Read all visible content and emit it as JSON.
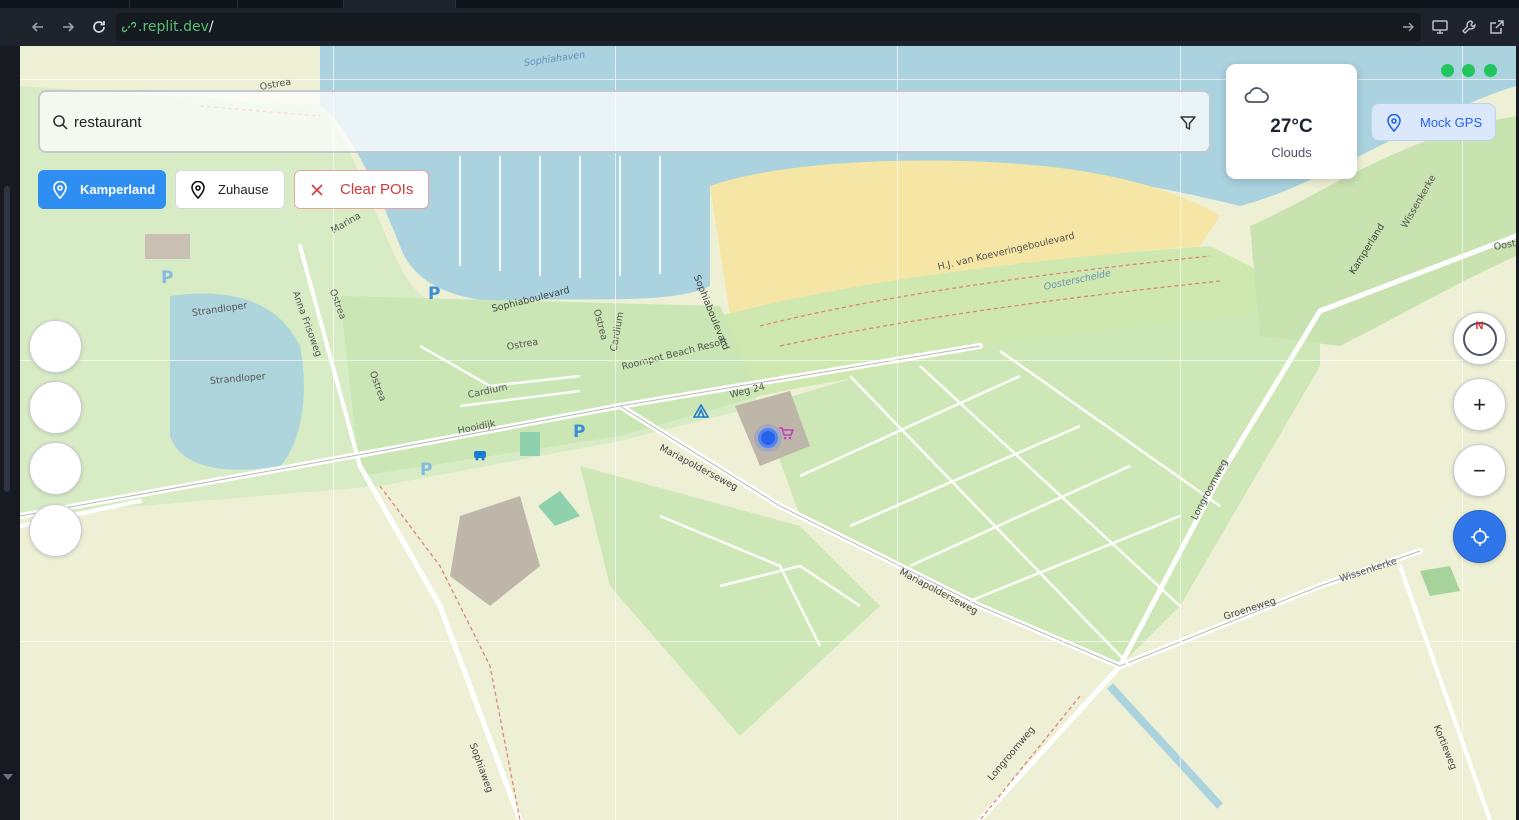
{
  "browser": {
    "url_domain": ".replit.dev",
    "url_path": "/"
  },
  "search": {
    "value": "restaurant",
    "placeholder": ""
  },
  "weather": {
    "temperature": "27°C",
    "condition": "Clouds",
    "icon": "cloud-icon"
  },
  "mock_gps": {
    "label": "Mock GPS"
  },
  "chips": {
    "kamperland": "Kamperland",
    "zuhause": "Zuhause",
    "clear_pois": "Clear POIs"
  },
  "controls": {
    "compass_label": "N",
    "zoom_in": "+",
    "zoom_out": "−"
  },
  "map": {
    "labels": {
      "sophiahaven": "Sophiahaven",
      "ostrea_1": "Ostrea",
      "ostrea_2": "Ostrea",
      "ostrea_3": "Ostrea",
      "ostrea_4": "Ostrea",
      "ostrea_5": "Ostrea",
      "marina": "Marina",
      "anna_frisoweg": "Anna Frisoweg",
      "strandloper_1": "Strandloper",
      "strandloper_2": "Strandloper",
      "sophiaboulevard_1": "Sophiaboulevard",
      "sophiaboulevard_2": "Sophiaboulevard",
      "cardium_1": "Cardium",
      "cardium_2": "Cardium",
      "roompot": "Roompot Beach Resort",
      "hooidijk": "Hooidijk",
      "weg24": "Weg 24",
      "mariapolderseweg_1": "Mariapolderseweg",
      "mariapolderseweg_2": "Mariapolderseweg",
      "koeveringe": "H.J. van Koeveringeboulevard",
      "oosterschelde": "Oosterschelde",
      "kamperland_road": "Kamperland",
      "wissenkerke_1": "Wissenkerke",
      "wissenkerke_2": "Wissenkerke",
      "oost": "Oost",
      "longroomweg_1": "Longroomweg",
      "longroomweg_2": "Longroomweg",
      "groeneweg": "Groeneweg",
      "kortieweg": "Kortieweg",
      "sophiaweg": "Sophiaweg"
    },
    "parking": "P"
  }
}
